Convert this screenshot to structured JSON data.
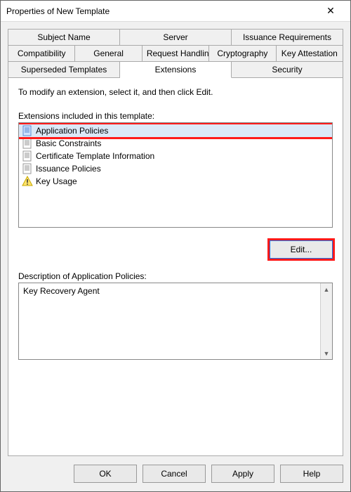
{
  "window": {
    "title": "Properties of New Template"
  },
  "tabs": {
    "row1": [
      "Subject Name",
      "Server",
      "Issuance Requirements"
    ],
    "row2": [
      "Compatibility",
      "General",
      "Request Handling",
      "Cryptography",
      "Key Attestation"
    ],
    "row3": [
      "Superseded Templates",
      "Extensions",
      "Security"
    ],
    "active": "Extensions"
  },
  "content": {
    "instruction": "To modify an extension, select it, and then click Edit.",
    "list_label": "Extensions included in this template:",
    "extensions": [
      {
        "name": "Application Policies",
        "icon": "doc",
        "selected": true
      },
      {
        "name": "Basic Constraints",
        "icon": "doc",
        "selected": false
      },
      {
        "name": "Certificate Template Information",
        "icon": "doc",
        "selected": false
      },
      {
        "name": "Issuance Policies",
        "icon": "doc",
        "selected": false
      },
      {
        "name": "Key Usage",
        "icon": "warn",
        "selected": false
      }
    ],
    "edit_button": "Edit...",
    "desc_label": "Description of Application Policies:",
    "desc_text": "Key Recovery Agent"
  },
  "footer": {
    "ok": "OK",
    "cancel": "Cancel",
    "apply": "Apply",
    "help": "Help"
  }
}
